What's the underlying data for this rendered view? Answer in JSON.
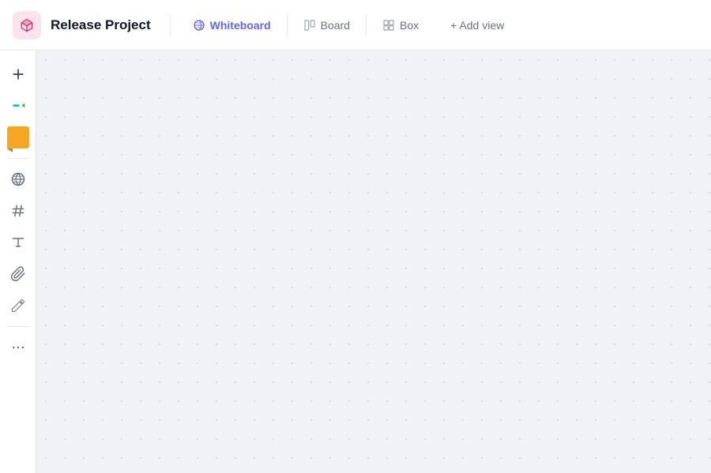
{
  "header": {
    "project_logo_alt": "Release Project logo",
    "project_title": "Release Project",
    "tabs": [
      {
        "id": "whiteboard",
        "label": "Whiteboard",
        "active": true,
        "icon": "whiteboard-icon"
      },
      {
        "id": "board",
        "label": "Board",
        "active": false,
        "icon": "board-icon"
      },
      {
        "id": "box",
        "label": "Box",
        "active": false,
        "icon": "box-icon"
      }
    ],
    "add_view_label": "+ Add view"
  },
  "sidebar": {
    "items": [
      {
        "id": "add",
        "icon": "plus-icon",
        "label": "Add"
      },
      {
        "id": "pen",
        "icon": "pen-icon",
        "label": "Pen"
      },
      {
        "id": "sticky",
        "icon": "sticky-note-icon",
        "label": "Sticky Note"
      },
      {
        "id": "globe",
        "icon": "globe-icon",
        "label": "Globe"
      },
      {
        "id": "hashtag",
        "icon": "hashtag-icon",
        "label": "Hashtag"
      },
      {
        "id": "text",
        "icon": "text-icon",
        "label": "Text"
      },
      {
        "id": "attach",
        "icon": "attach-icon",
        "label": "Attach"
      },
      {
        "id": "draw",
        "icon": "draw-icon",
        "label": "Draw"
      },
      {
        "id": "more",
        "icon": "more-icon",
        "label": "More"
      }
    ]
  },
  "canvas": {
    "background_color": "#f0f2f5"
  }
}
